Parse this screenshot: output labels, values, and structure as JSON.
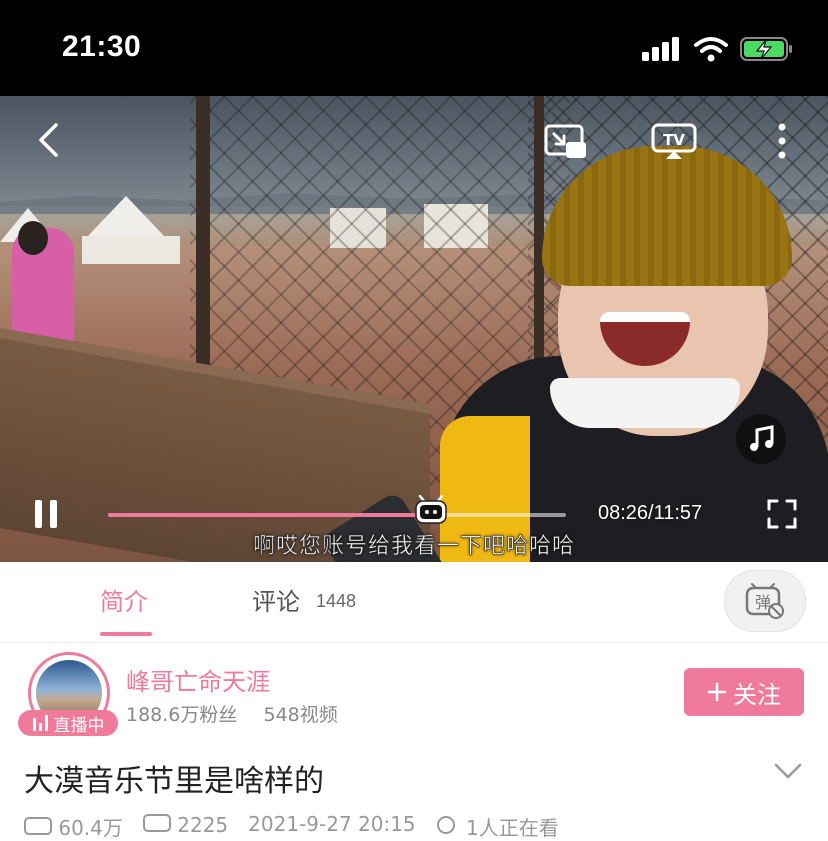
{
  "status_bar": {
    "time": "21:30"
  },
  "player": {
    "subtitle": "啊哎您账号给我看一下吧哈哈哈",
    "current_time": "08:26",
    "duration": "11:57",
    "time_readout": "08:26/11:57",
    "progress_fraction": 0.705,
    "icons": {
      "back": "back-arrow-icon",
      "pip": "picture-in-picture-icon",
      "cast": "tv-cast-icon",
      "more": "more-vertical-icon",
      "music": "music-note-icon",
      "pause": "pause-icon",
      "fullscreen": "fullscreen-icon"
    }
  },
  "tabs": {
    "intro_label": "简介",
    "comments_label": "评论",
    "comments_count": "1448",
    "danmaku_icon": "danmaku-toggle-icon"
  },
  "uploader": {
    "name": "峰哥亡命天涯",
    "fans": "188.6万粉丝",
    "videos": "548视频",
    "live_label": "直播中",
    "follow_label": "关注"
  },
  "video": {
    "title": "大漠音乐节里是啥样的",
    "meta": [
      "60.4万",
      "2225",
      "2021-9-27 20:15",
      "1人正在看"
    ]
  },
  "colors": {
    "accent": "#f07a9c"
  }
}
